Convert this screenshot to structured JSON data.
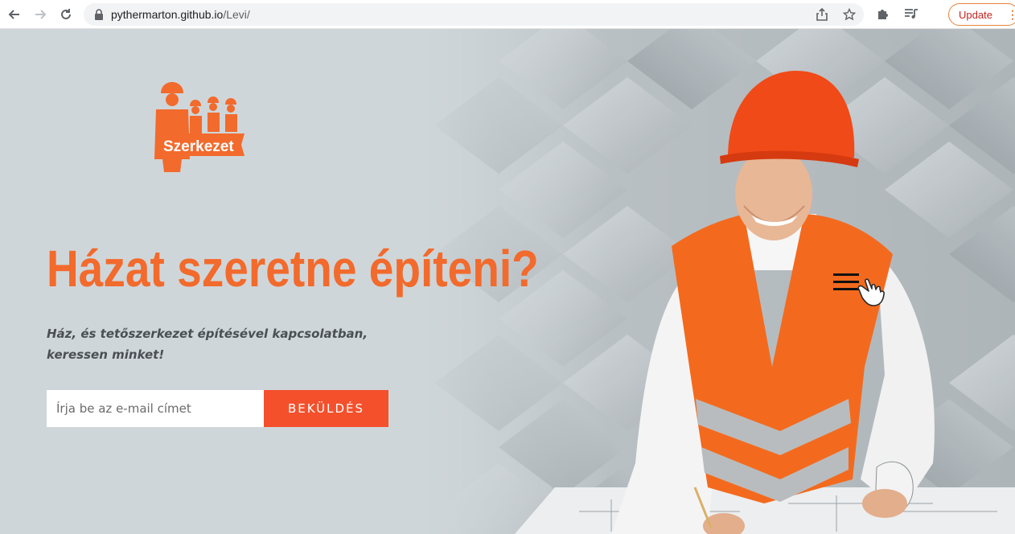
{
  "browser": {
    "url_host": "pythermarton.github.io",
    "url_path": "/Levi/",
    "update_label": "Update",
    "menu_dots": "⋮"
  },
  "hero": {
    "logo_text": "Szerkezet",
    "headline": "Házat szeretne építeni?",
    "subline": "Ház, és tetőszerkezet építésével kapcsolatban, keressen minket!",
    "email_placeholder": "Írja be az e-mail címet",
    "submit_label": "BEKÜLDÉS"
  },
  "colors": {
    "accent": "#f26a2c",
    "button": "#f4502b"
  }
}
